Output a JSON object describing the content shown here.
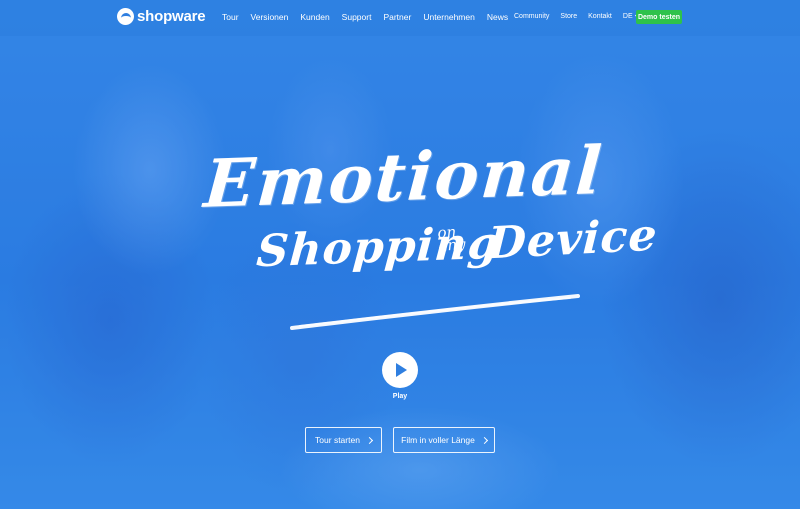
{
  "brand": {
    "name": "shopware",
    "accent": "#2f7fe0",
    "cta_green": "#2ec24b"
  },
  "nav": {
    "main": [
      "Tour",
      "Versionen",
      "Kunden",
      "Support",
      "Partner",
      "Unternehmen",
      "News"
    ],
    "meta": [
      "Community",
      "Store",
      "Kontakt"
    ],
    "language": "DE",
    "demo_label": "Demo testen"
  },
  "hero": {
    "line1": "Emotional",
    "line2": "Shopping",
    "line2_small_1": "on",
    "line2_small_2": "any",
    "line2_end": "Device",
    "play_label": "Play",
    "buttons": {
      "tour": "Tour starten",
      "film": "Film in voller Länge"
    },
    "icons": {
      "play": "play-icon",
      "chevron": "chevron-right-icon"
    }
  }
}
